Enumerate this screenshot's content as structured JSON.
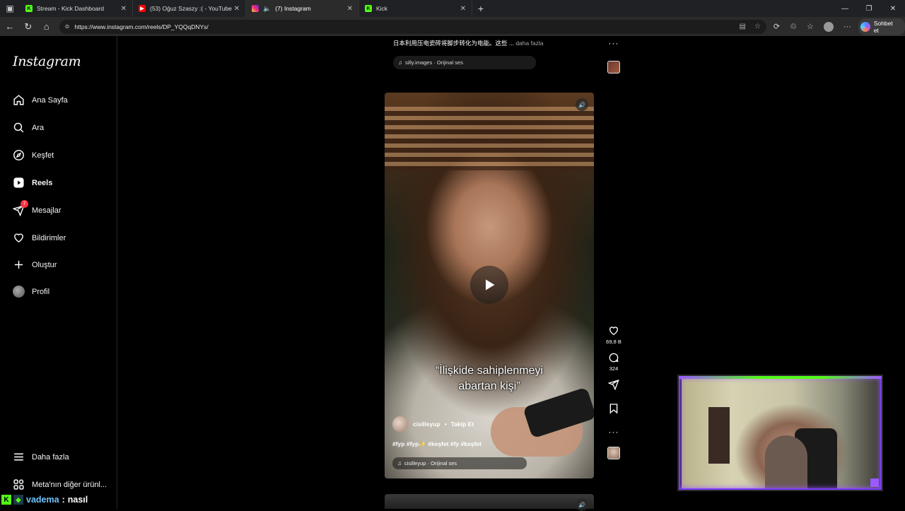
{
  "browser": {
    "tabs": [
      {
        "title": "Stream - Kick Dashboard",
        "favicon": "kick-icon",
        "active": false
      },
      {
        "title": "(53) Oğuz Szaszy :( - YouTube",
        "favicon": "youtube-icon",
        "active": false
      },
      {
        "title": "(7) Instagram",
        "favicon": "instagram-icon",
        "active": true
      },
      {
        "title": "Kick",
        "favicon": "kick-icon",
        "active": false
      }
    ],
    "url": "https://www.instagram.com/reels/DP_YQQqDNYs/",
    "copilot_label": "Sohbet et"
  },
  "sidebar": {
    "logo": "Instagram",
    "items": [
      {
        "label": "Ana Sayfa",
        "icon": "home-icon"
      },
      {
        "label": "Ara",
        "icon": "search-icon"
      },
      {
        "label": "Keşfet",
        "icon": "compass-icon"
      },
      {
        "label": "Reels",
        "icon": "reels-icon",
        "active": true
      },
      {
        "label": "Mesajlar",
        "icon": "messenger-icon",
        "badge": "7"
      },
      {
        "label": "Bildirimler",
        "icon": "heart-icon"
      },
      {
        "label": "Oluştur",
        "icon": "plus-icon"
      },
      {
        "label": "Profil",
        "icon": "avatar"
      }
    ],
    "more_label": "Daha fazla",
    "meta_label": "Meta'nın diğer ürünl..."
  },
  "previous_reel": {
    "caption": "日本利用压电瓷砖将脚步转化为电能。这些 ...",
    "more_label": "daha fazla",
    "audio": "silly.images · Orijinal ses"
  },
  "reel": {
    "subtitle_line1": "“İlişkide sahiplenmeyi",
    "subtitle_line2": "abartan kişi”",
    "author": "cisilleyup",
    "follow_label": "Takip Et",
    "hashtags": "#fyp #fyp✨ #keşfet #fy #keşfet",
    "audio": "cisilleyup · Orijinal ses",
    "likes": "69,8 B",
    "comments": "324"
  },
  "chat": {
    "username": "vadema",
    "message": "nasıl"
  },
  "colors": {
    "kick_green": "#53fc18",
    "instagram_badge": "#ff3040",
    "webcam_frame": "#9b59ff"
  }
}
